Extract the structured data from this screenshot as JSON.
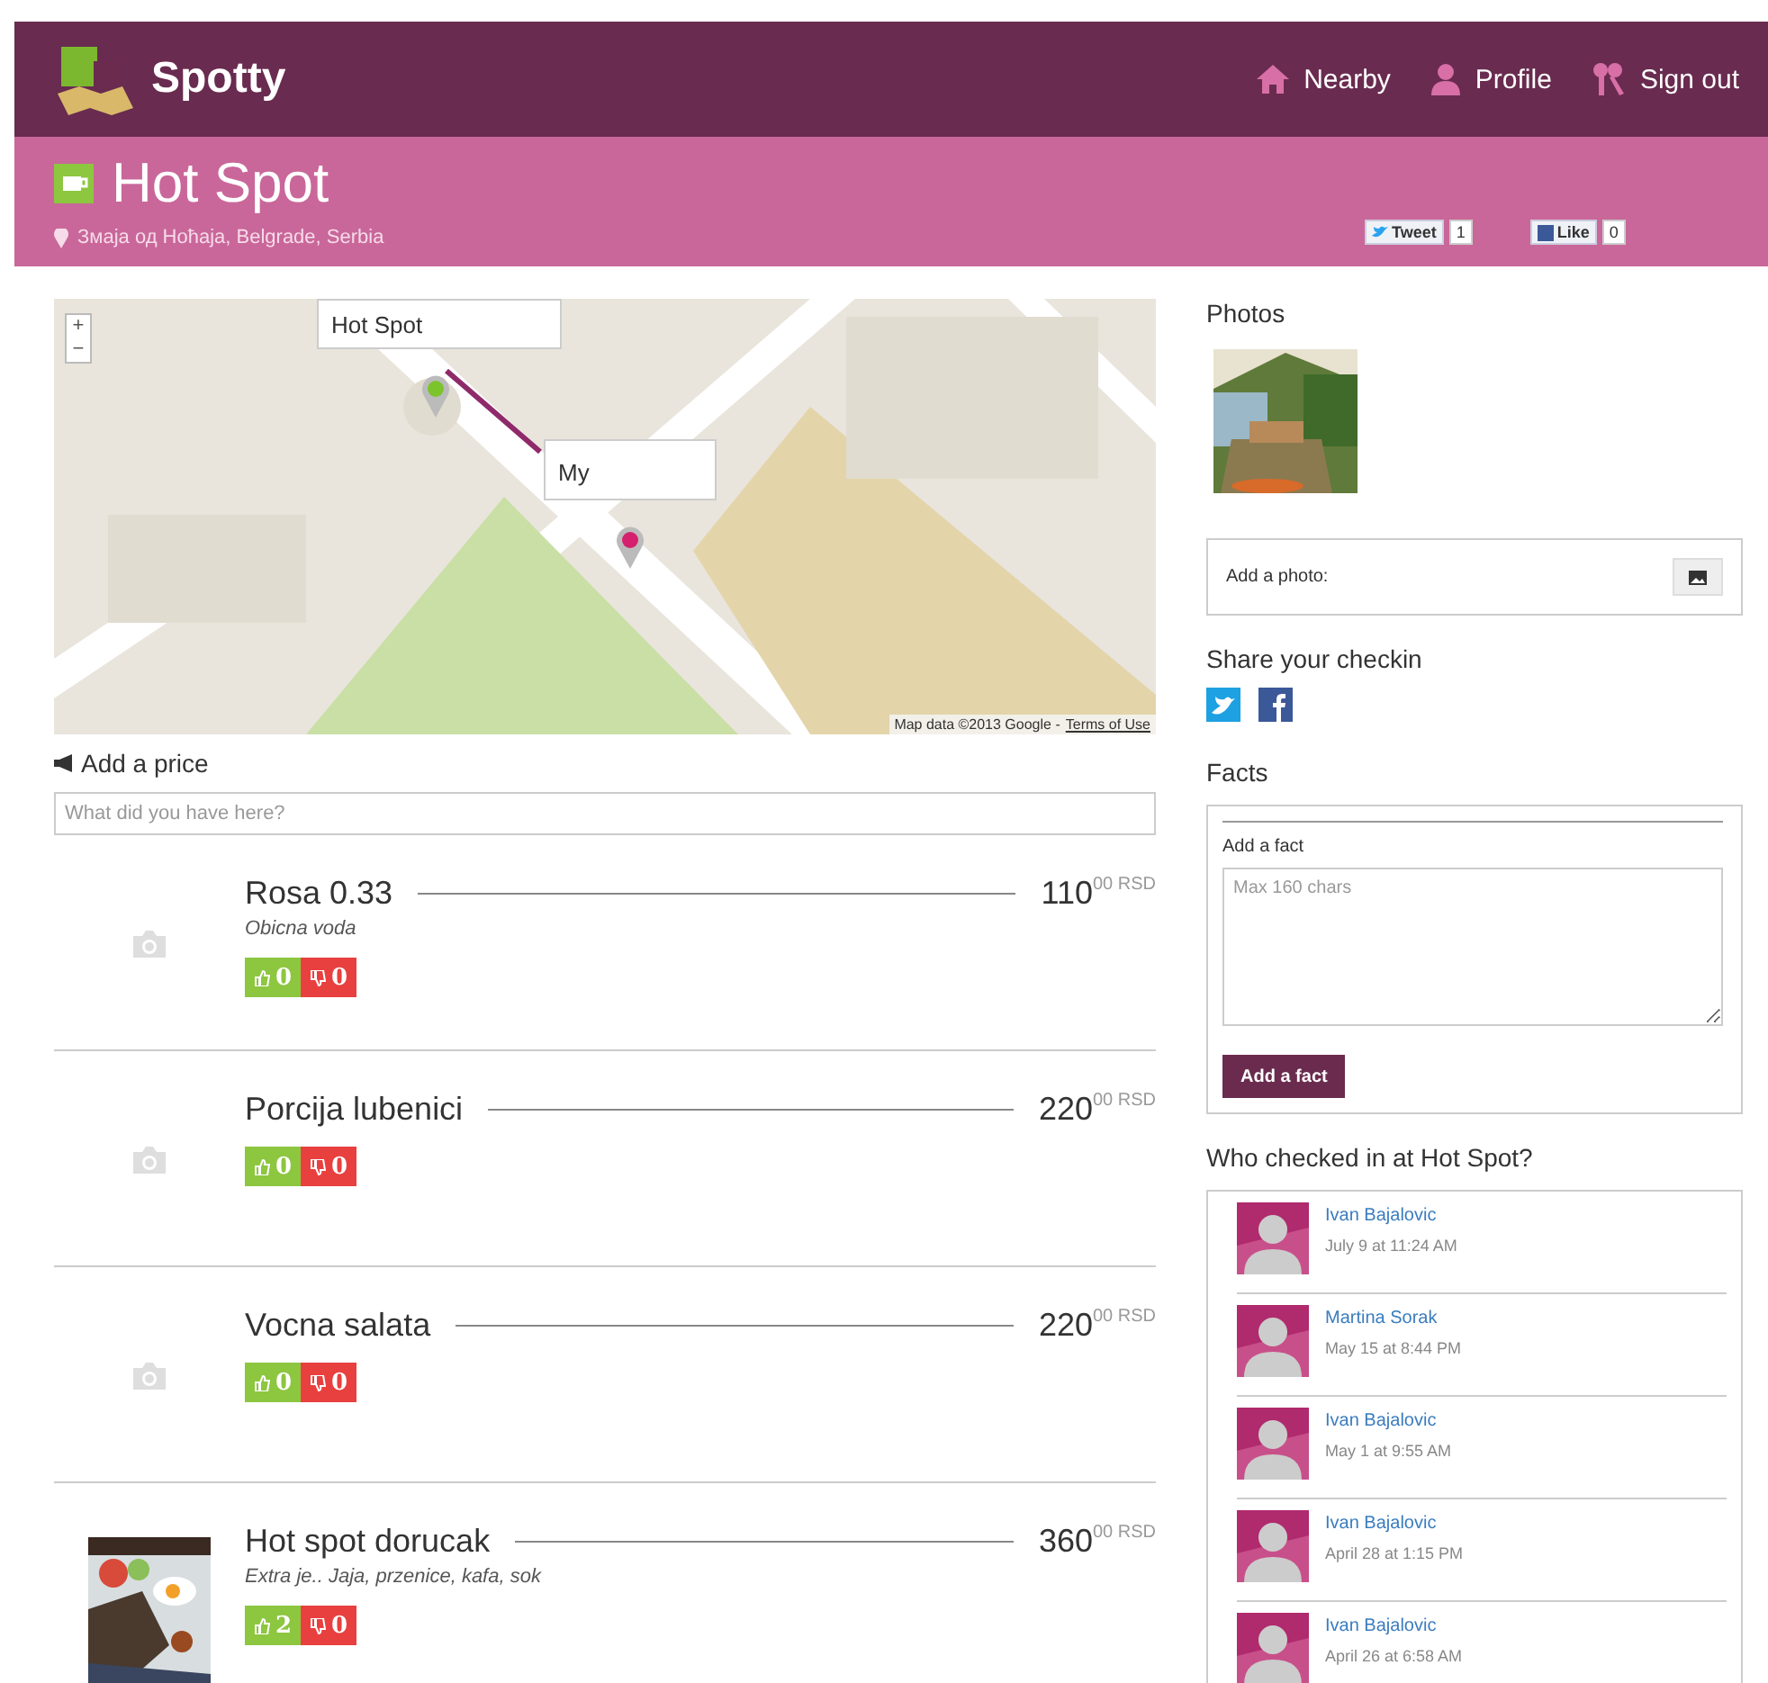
{
  "app": {
    "name": "Spotty"
  },
  "nav": [
    {
      "label": "Nearby",
      "kind": "home"
    },
    {
      "label": "Profile",
      "kind": "person"
    },
    {
      "label": "Sign out",
      "kind": "keys"
    }
  ],
  "place": {
    "name": "Hot Spot",
    "address": "Змаја од Ноћаја, Belgrade, Serbia",
    "tweet": {
      "label": "Tweet",
      "count": "1"
    },
    "like": {
      "label": "Like",
      "count": "0"
    }
  },
  "map": {
    "zoom_in": "+",
    "zoom_out": "−",
    "info_windows": [
      "Hot Spot",
      "My"
    ],
    "attribution": "Map data ©2013 Google -",
    "terms": "Terms of Use"
  },
  "add_price": {
    "label": "Add a price",
    "placeholder": "What did you have here?"
  },
  "items": [
    {
      "kind": "placeholder",
      "name": "Rosa 0.33",
      "description": "Obicna voda",
      "price": "110",
      "cents": "00",
      "currency": "RSD",
      "up": "0",
      "down": "0"
    },
    {
      "kind": "placeholder",
      "name": "Porcija lubenici",
      "price": "220",
      "cents": "00",
      "currency": "RSD",
      "up": "0",
      "down": "0"
    },
    {
      "kind": "placeholder",
      "name": "Vocna salata",
      "price": "220",
      "cents": "00",
      "currency": "RSD",
      "up": "0",
      "down": "0"
    },
    {
      "name": "Hot spot dorucak",
      "description": "Extra je.. Jaja, przenice, kafa, sok",
      "price": "360",
      "cents": "00",
      "currency": "RSD",
      "up": "2",
      "down": "0"
    }
  ],
  "sidebar": {
    "photos_title": "Photos",
    "add_photo": "Add a photo:",
    "share_title": "Share your checkin",
    "facts_title": "Facts",
    "add_fact_label": "Add a fact",
    "fact_placeholder": "Max 160 chars",
    "add_fact_button": "Add a fact",
    "checkins_title": "Who checked in at Hot Spot?",
    "checkins": [
      {
        "name": "Ivan Bajalovic",
        "time": "July 9 at 11:24 AM"
      },
      {
        "name": "Martina Sorak",
        "time": "May 15 at 8:44 PM"
      },
      {
        "name": "Ivan Bajalovic",
        "time": "May 1 at 9:55 AM"
      },
      {
        "name": "Ivan Bajalovic",
        "time": "April 28 at 1:15 PM"
      },
      {
        "name": "Ivan Bajalovic",
        "time": "April 26 at 6:58 AM"
      }
    ]
  }
}
